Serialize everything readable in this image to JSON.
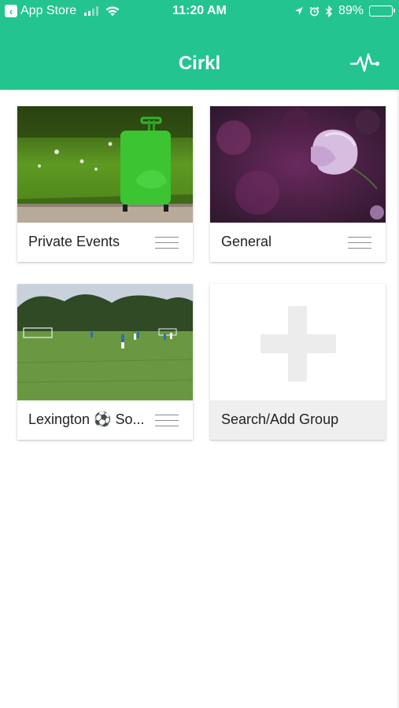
{
  "status_bar": {
    "back_app": "App Store",
    "time": "11:20 AM",
    "battery": "89%",
    "battery_level": 0.89,
    "signal_bars": 2
  },
  "header": {
    "title": "Cirkl",
    "activity_icon": "activity-pulse-icon"
  },
  "groups": [
    {
      "name": "Private Events",
      "photo": "green suitcase on grass"
    },
    {
      "name": "General",
      "photo": "purple flower"
    },
    {
      "name": "Lexington ⚽ So...",
      "photo": "soccer field with players"
    }
  ],
  "add_group": {
    "label": "Search/Add Group",
    "icon": "plus-icon"
  },
  "colors": {
    "brand": "#23c48f",
    "add_tile_bar": "#efefef",
    "plus": "#ececec"
  }
}
